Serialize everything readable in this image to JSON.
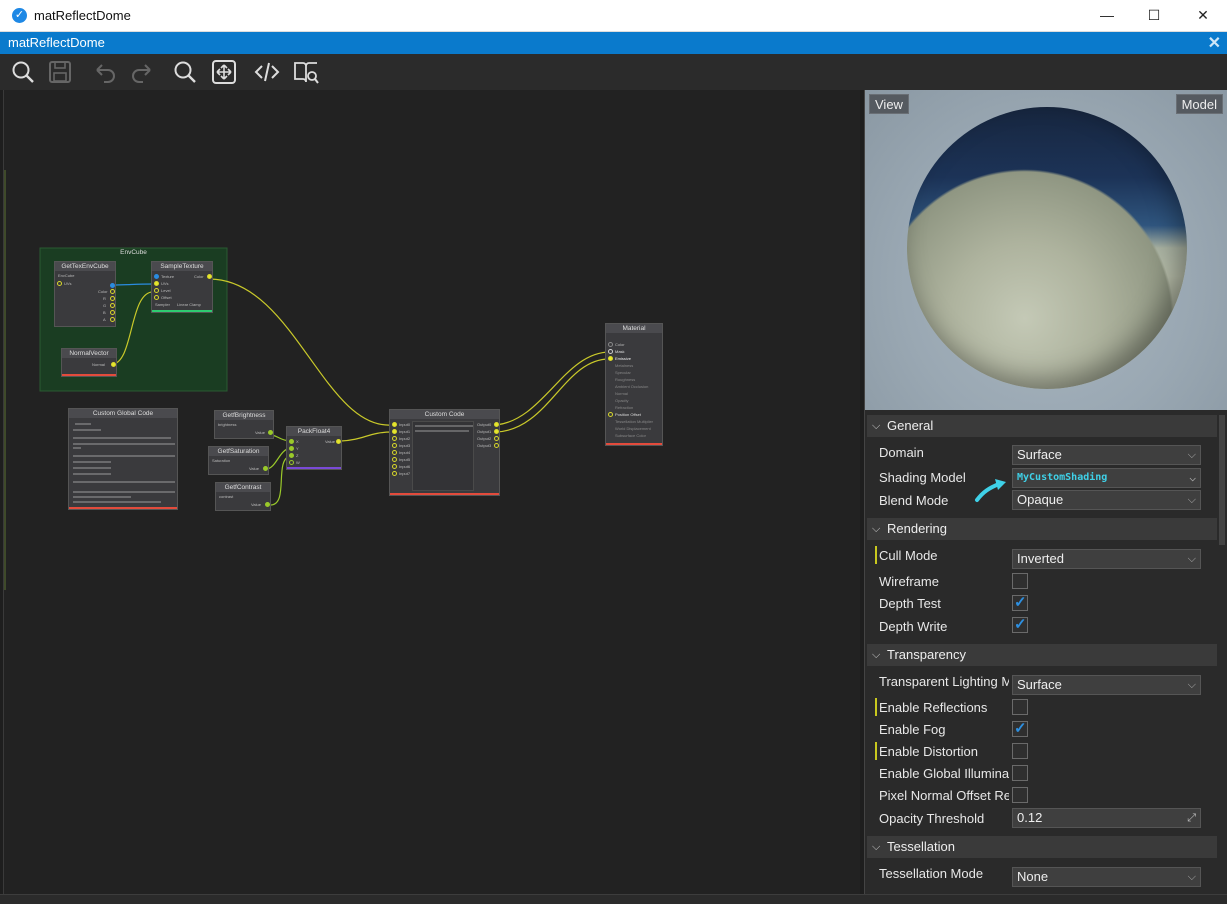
{
  "window": {
    "title": "matReflectDome",
    "minimize": "—",
    "maximize": "☐",
    "close": "✕"
  },
  "tab": {
    "title": "matReflectDome",
    "close": "✕"
  },
  "toolbar": {
    "items": [
      "search-icon",
      "save-icon",
      "undo-icon",
      "redo-icon",
      "zoom-icon",
      "fit-view-icon",
      "code-icon",
      "docs-search-icon"
    ]
  },
  "graph": {
    "group_title": "EnvCube",
    "nodes": {
      "get_tex_env": {
        "title": "GetTexEnvCube",
        "rows": [
          "EnvCube",
          "UVs",
          "Color",
          "R",
          "G",
          "B",
          "A"
        ]
      },
      "sample_texture": {
        "title": "SampleTexture",
        "rows": [
          "Texture",
          "UVs",
          "Level",
          "Offset",
          "Sampler",
          "Linear Clamp"
        ],
        "out": "Color"
      },
      "normal_vector": {
        "title": "NormalVector",
        "out": "Normal"
      },
      "custom_global": {
        "title": "Custom Global Code"
      },
      "get_brightness": {
        "title": "GetfBrightness",
        "row": "brightness",
        "out": "Value"
      },
      "get_saturation": {
        "title": "GetfSaturation",
        "row": "Saturation",
        "out": "Value"
      },
      "get_contrast": {
        "title": "GetfContrast",
        "row": "contrast",
        "out": "Value"
      },
      "pack_float4": {
        "title": "PackFloat4",
        "rows": [
          "X",
          "Y",
          "Z",
          "W"
        ],
        "out": "Value"
      },
      "custom_code": {
        "title": "Custom Code",
        "inputs": [
          "Input0",
          "Input1",
          "Input2",
          "Input3",
          "Input4",
          "Input5",
          "Input6",
          "Input7"
        ],
        "outputs": [
          "Output0",
          "Output1",
          "Output2",
          "Output3"
        ]
      },
      "material": {
        "title": "Material",
        "rows": [
          "Color",
          "Mask",
          "Emissive",
          "Metalness",
          "Specular",
          "Roughness",
          "Ambient Occlusion",
          "Normal",
          "Opacity",
          "Refraction",
          "Position Offset",
          "Tessellation Multiplier",
          "World Displacement",
          "Subsurface Color"
        ]
      }
    }
  },
  "preview": {
    "view_button": "View",
    "model_button": "Model"
  },
  "properties": {
    "general": {
      "header": "General",
      "domain_label": "Domain",
      "domain_value": "Surface",
      "shading_label": "Shading Model",
      "shading_value": "MyCustomShading",
      "blend_label": "Blend Mode",
      "blend_value": "Opaque"
    },
    "rendering": {
      "header": "Rendering",
      "cull_label": "Cull Mode",
      "cull_value": "Inverted",
      "wireframe_label": "Wireframe",
      "wireframe": false,
      "depth_test_label": "Depth Test",
      "depth_test": true,
      "depth_write_label": "Depth Write",
      "depth_write": true
    },
    "transparency": {
      "header": "Transparency",
      "lighting_label": "Transparent Lighting M",
      "lighting_value": "Surface",
      "reflections_label": "Enable Reflections",
      "reflections": false,
      "fog_label": "Enable Fog",
      "fog": true,
      "distortion_label": "Enable Distortion",
      "distortion": false,
      "gi_label": "Enable Global Illuminat",
      "gi": false,
      "pixel_normal_label": "Pixel Normal Offset Re",
      "pixel_normal": false,
      "opacity_label": "Opacity Threshold",
      "opacity_value": "0.12"
    },
    "tessellation": {
      "header": "Tessellation",
      "mode_label": "Tessellation Mode",
      "mode_value": "None"
    }
  },
  "colors": {
    "accent": "#0a7acc",
    "annotation_arrow": "#3fd1e8",
    "wire": "#c9c92a",
    "check": "#2d8fe0"
  }
}
